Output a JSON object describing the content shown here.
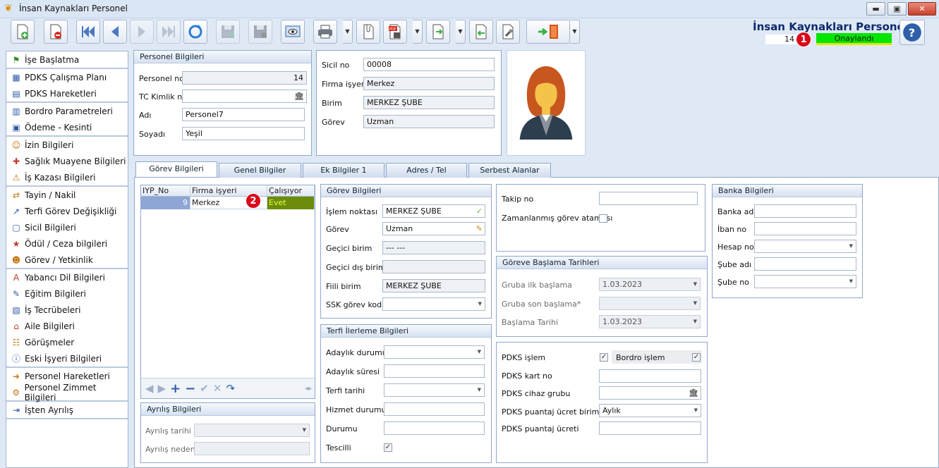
{
  "window": {
    "title": "İnsan Kaynakları Personel",
    "minimize": "▬",
    "maximize": "▣",
    "close": "✕"
  },
  "header": {
    "app_title": "İnsan Kaynakları Personel",
    "record_no": "14",
    "status": "Onaylandı",
    "status_color": "#00e600",
    "callout1": "1",
    "callout2": "2"
  },
  "sidebar": {
    "groups": [
      [
        {
          "label": "İşe Başlatma",
          "icon": "flag-icon"
        }
      ],
      [
        {
          "label": "PDKS Çalışma Planı",
          "icon": "schedule-icon"
        },
        {
          "label": "PDKS Hareketleri",
          "icon": "clock-list-icon"
        }
      ],
      [
        {
          "label": "Bordro Parametreleri",
          "icon": "payroll-icon"
        },
        {
          "label": "Ödeme - Kesinti",
          "icon": "payment-icon"
        }
      ],
      [
        {
          "label": "İzin Bilgileri",
          "icon": "leave-icon"
        },
        {
          "label": "Sağlık Muayene Bilgileri",
          "icon": "health-icon"
        },
        {
          "label": "İş Kazası Bilgileri",
          "icon": "accident-icon"
        }
      ],
      [
        {
          "label": "Tayin / Nakil",
          "icon": "transfer-icon"
        },
        {
          "label": "Terfi Görev Değişikliği",
          "icon": "promotion-icon"
        },
        {
          "label": "Sicil Bilgileri",
          "icon": "record-icon"
        },
        {
          "label": "Ödül / Ceza bilgileri",
          "icon": "award-icon"
        },
        {
          "label": "Görev / Yetkinlik",
          "icon": "competence-icon"
        }
      ],
      [
        {
          "label": "Yabancı Dil Bilgileri",
          "icon": "language-icon"
        },
        {
          "label": "Eğitim Bilgileri",
          "icon": "education-icon"
        },
        {
          "label": "İş Tecrübeleri",
          "icon": "experience-icon"
        },
        {
          "label": "Aile Bilgileri",
          "icon": "family-icon"
        },
        {
          "label": "Görüşmeler",
          "icon": "meeting-icon"
        },
        {
          "label": "Eski İşyeri Bilgileri",
          "icon": "info-icon"
        }
      ],
      [
        {
          "label": "Personel Hareketleri",
          "icon": "movement-icon"
        },
        {
          "label": "Personel Zimmet Bilgileri",
          "icon": "assets-icon"
        }
      ],
      [
        {
          "label": "İşten Ayrılış",
          "icon": "exit-icon"
        }
      ]
    ]
  },
  "personel": {
    "title": "Personel Bilgileri",
    "no_label": "Personel no",
    "no_value": "14",
    "tc_label": "TC Kimlik no",
    "tc_value": "",
    "ad_label": "Adı",
    "ad_value": "Personel7",
    "soyad_label": "Soyadı",
    "soyad_value": "Yeşil"
  },
  "sicil": {
    "sicil_label": "Sicil no",
    "sicil_value": "00008",
    "firma_label": "Firma işyeri",
    "firma_value": "Merkez",
    "birim_label": "Birim",
    "birim_value": "MERKEZ ŞUBE",
    "gorev_label": "Görev",
    "gorev_value": "Uzman"
  },
  "tabs": [
    "Görev Bilgileri",
    "Genel Bilgiler",
    "Ek Bilgiler 1",
    "Adres / Tel",
    "Serbest Alanlar"
  ],
  "grid": {
    "columns": [
      "IYP_No",
      "Firma işyeri",
      "Çalışıyor"
    ],
    "rows": [
      {
        "iyp": "9",
        "firma": "Merkez",
        "calisiyor": "Evet"
      }
    ],
    "nav": [
      "◀",
      "▶",
      "+",
      "−",
      "✔",
      "✕",
      "↷",
      "◂▸"
    ]
  },
  "ayrilis": {
    "title": "Ayrılış Bilgileri",
    "tarih_label": "Ayrılış tarihi",
    "neden_label": "Ayrılış nedeni"
  },
  "gorev": {
    "title": "Görev Bilgileri",
    "islem_label": "İşlem noktası",
    "islem_value": "MERKEZ ŞUBE",
    "gorev_label": "Görev",
    "gorev_value": "Uzman",
    "gecici_label": "Geçici birim",
    "gecici_value": "--- ---",
    "gecicidis_label": "Geçici dış birim",
    "gecicidis_value": "",
    "fiili_label": "Fiili birim",
    "fiili_value": "MERKEZ ŞUBE",
    "ssk_label": "SSK görev kodu",
    "ssk_value": ""
  },
  "terfi": {
    "title": "Terfi İlerleme Bilgileri",
    "adaylik_label": "Adaylık durumu",
    "adaylik_sure_label": "Adaylık süresi",
    "terfi_tarih_label": "Terfi tarihi",
    "hizmet_label": "Hizmet durumu",
    "durum_label": "Durumu",
    "tescil_label": "Tescilli",
    "tescil_checked": true
  },
  "takip": {
    "takip_label": "Takip no",
    "takip_value": "",
    "zaman_label": "Zamanlanmış görev ataması",
    "zaman_checked": false
  },
  "baslama": {
    "title": "Göreve Başlama Tarihleri",
    "ilk_label": "Gruba ilk başlama",
    "ilk_value": "1.03.2023",
    "son_label": "Gruba son başlama*",
    "son_value": "",
    "tarih_label": "Başlama Tarihi",
    "tarih_value": "1.03.2023"
  },
  "pdks": {
    "islem_label": "PDKS işlem",
    "islem_checked": true,
    "bordro_label": "Bordro işlem",
    "bordro_checked": true,
    "kart_label": "PDKS kart no",
    "cihaz_label": "PDKS cihaz grubu",
    "puantaj_birim_label": "PDKS puantaj ücret birimi",
    "puantaj_birim_value": "Aylık",
    "puantaj_ucret_label": "PDKS puantaj ücreti"
  },
  "banka": {
    "title": "Banka Bilgileri",
    "adi_label": "Banka adı",
    "iban_label": "İban no",
    "hesap_label": "Hesap no",
    "sube_adi_label": "Şube adı",
    "sube_no_label": "Şube no"
  },
  "colors": {
    "accent": "#0d2b6b",
    "status_green": "#00e600",
    "grid_select": "#6b8b0a",
    "badge": "#d9091b"
  }
}
